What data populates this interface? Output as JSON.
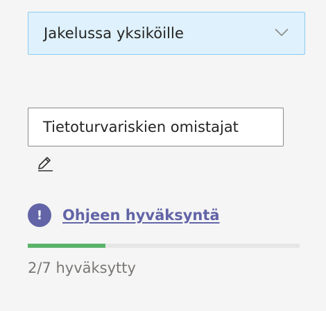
{
  "distribution": {
    "selected_value": "Jakelussa yksiköille",
    "icon": "chevron-down-icon"
  },
  "owner": {
    "label": "Tietoturvariskien omistajat",
    "edit_icon": "pencil-icon"
  },
  "approval": {
    "link_text": "Ohjeen hyväksyntä",
    "icon": "exclamation-icon",
    "icon_glyph": "!",
    "progress_fraction": 0.2857,
    "status_text": "2/7 hyväksytty"
  },
  "colors": {
    "accent": "#6264a7",
    "progress": "#5bb46a",
    "dropdown_bg": "#def1fc",
    "dropdown_border": "#8cccf0"
  }
}
